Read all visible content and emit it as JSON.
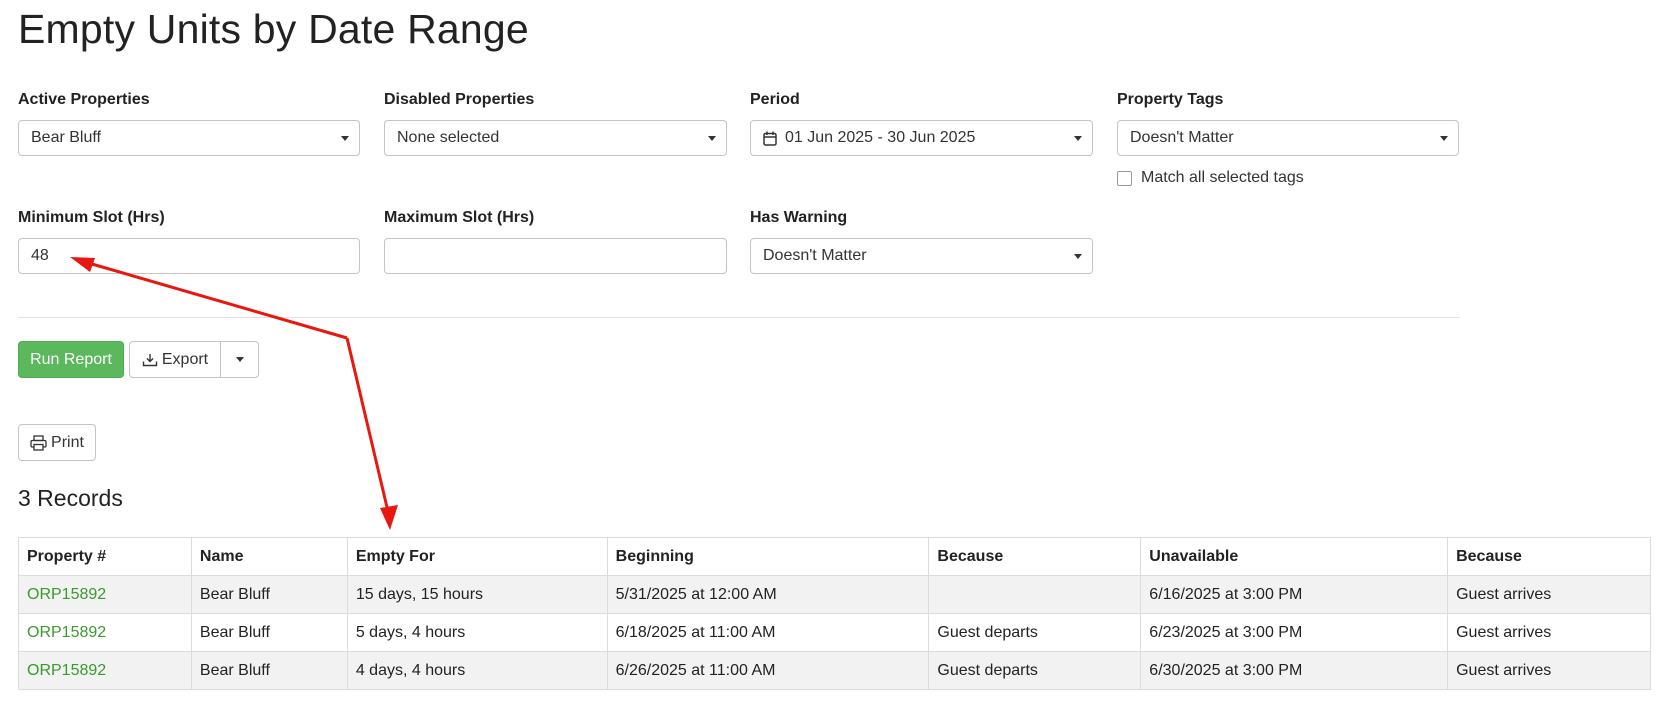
{
  "page": {
    "title": "Empty Units by Date Range"
  },
  "filters": {
    "active_properties": {
      "label": "Active Properties",
      "value": "Bear Bluff"
    },
    "disabled_properties": {
      "label": "Disabled Properties",
      "value": "None selected"
    },
    "period": {
      "label": "Period",
      "value": "01 Jun 2025 - 30 Jun 2025"
    },
    "property_tags": {
      "label": "Property Tags",
      "value": "Doesn't Matter",
      "match_all_label": "Match all selected tags",
      "match_all_checked": false
    },
    "min_slot": {
      "label": "Minimum Slot (Hrs)",
      "value": "48"
    },
    "max_slot": {
      "label": "Maximum Slot (Hrs)",
      "value": ""
    },
    "has_warning": {
      "label": "Has Warning",
      "value": "Doesn't Matter"
    }
  },
  "actions": {
    "run_report": "Run Report",
    "export": "Export",
    "print": "Print"
  },
  "results": {
    "count_label": "3 Records",
    "columns": [
      "Property #",
      "Name",
      "Empty For",
      "Beginning",
      "Because",
      "Unavailable",
      "Because"
    ],
    "rows": [
      [
        "ORP15892",
        "Bear Bluff",
        "15 days, 15 hours",
        "5/31/2025 at 12:00 AM",
        "",
        "6/16/2025 at 3:00 PM",
        "Guest arrives"
      ],
      [
        "ORP15892",
        "Bear Bluff",
        "5 days, 4 hours",
        "6/18/2025 at 11:00 AM",
        "Guest departs",
        "6/23/2025 at 3:00 PM",
        "Guest arrives"
      ],
      [
        "ORP15892",
        "Bear Bluff",
        "4 days, 4 hours",
        "6/26/2025 at 11:00 AM",
        "Guest departs",
        "6/30/2025 at 3:00 PM",
        "Guest arrives"
      ]
    ]
  },
  "annotation": {
    "arrow_color": "#e8170f"
  },
  "colors": {
    "run_button": "#5cb85c",
    "link": "#3b9a2e"
  },
  "icons": {
    "period": "calendar-icon",
    "export": "download-icon",
    "print": "printer-icon"
  }
}
